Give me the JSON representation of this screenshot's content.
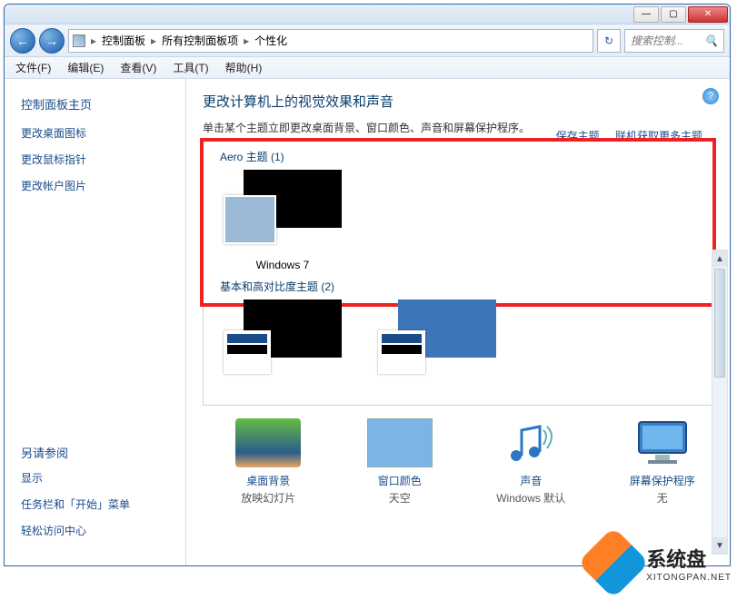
{
  "titlebar": {
    "min": "—",
    "max": "▢",
    "close": "✕"
  },
  "nav": {
    "back": "←",
    "forward": "→",
    "path": [
      "控制面板",
      "所有控制面板项",
      "个性化"
    ],
    "sep": "▸",
    "refresh": "↻",
    "search_placeholder": "搜索控制...",
    "search_icon": "🔍"
  },
  "menu": {
    "file": "文件(F)",
    "edit": "编辑(E)",
    "view": "查看(V)",
    "tools": "工具(T)",
    "help": "帮助(H)"
  },
  "help_icon": "?",
  "sidebar": {
    "home": "控制面板主页",
    "links": [
      "更改桌面图标",
      "更改鼠标指针",
      "更改帐户图片"
    ],
    "see_also_title": "另请参阅",
    "see_also": [
      "显示",
      "任务栏和「开始」菜单",
      "轻松访问中心"
    ]
  },
  "main": {
    "heading": "更改计算机上的视觉效果和声音",
    "subtitle": "单击某个主题立即更改桌面背景、窗口颜色、声音和屏幕保护程序。",
    "links": {
      "save": "保存主题",
      "more": "联机获取更多主题"
    },
    "aero_group": "Aero 主题 (1)",
    "aero_theme_name": "Windows 7",
    "basic_group": "基本和高对比度主题 (2)"
  },
  "bottom": {
    "wallpaper": {
      "title": "桌面背景",
      "sub": "放映幻灯片"
    },
    "color": {
      "title": "窗口颜色",
      "sub": "天空"
    },
    "sound": {
      "title": "声音",
      "sub": "Windows 默认"
    },
    "screensaver": {
      "title": "屏幕保护程序",
      "sub": "无"
    }
  },
  "watermark": {
    "text": "系统盘",
    "url": "XITONGPAN.NET"
  }
}
